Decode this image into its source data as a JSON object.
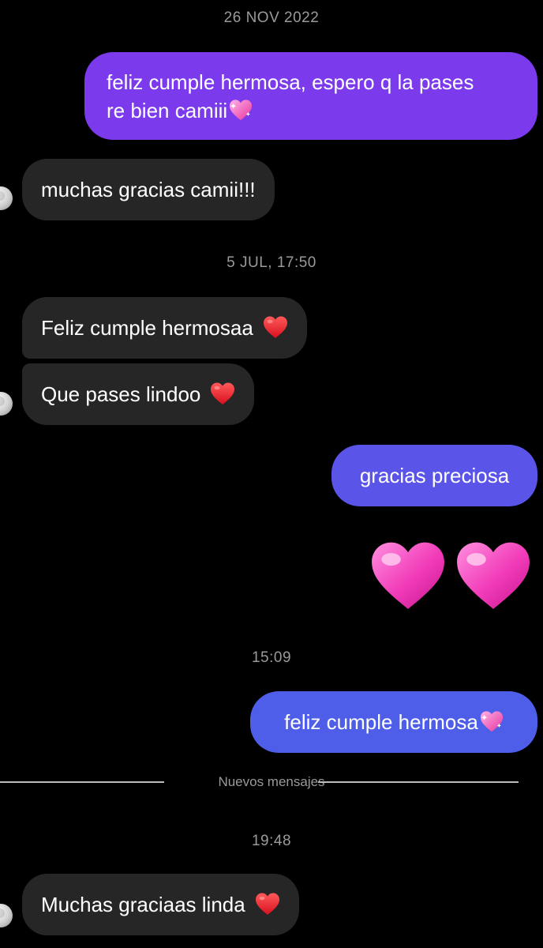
{
  "chat": {
    "timestamps": {
      "t1": "26 NOV 2022",
      "t2": "5 JUL, 17:50",
      "t3": "15:09",
      "t4": "19:48"
    },
    "messages": {
      "m1_line1": "feliz cumple hermosa, espero q la pases",
      "m1_line2": "re bien camiii",
      "m2": "muchas gracias camii!!!",
      "m3": "Feliz cumple hermosaa",
      "m4": "Que pases lindoo",
      "m5": "gracias preciosa",
      "m7": "feliz cumple hermosa",
      "m8": "Muchas graciaas linda"
    },
    "divider_label": "Nuevos mensajes",
    "icons": {
      "sparkling_heart": "sparkling-heart-emoji",
      "red_heart": "red-heart-emoji",
      "pink_heart": "pink-heart-emoji"
    },
    "colors": {
      "outgoing_purple": "#7c3aed",
      "outgoing_indigo": "#5b54e8",
      "outgoing_blue": "#4e5ee8",
      "incoming": "#262626",
      "background": "#000000"
    }
  }
}
